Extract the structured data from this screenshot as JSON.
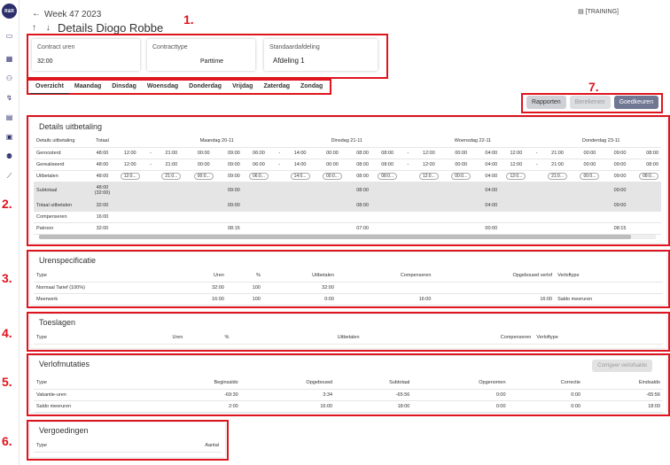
{
  "logo": "R&R",
  "header": {
    "back": "←",
    "week": "Week 47 2023",
    "arrows": "↑ ↓",
    "title": "Details Diogo Robbe",
    "training": "[TRAINING]"
  },
  "annotations": [
    "1.",
    "2.",
    "3.",
    "4.",
    "5.",
    "6.",
    "7."
  ],
  "info": {
    "contract_uren_label": "Contract uren",
    "contract_uren": "32:00",
    "contracttype_label": "Contracttype",
    "contracttype": "Parttime",
    "afdeling_label": "Standaardafdeling",
    "afdeling": "Afdeling 1"
  },
  "tabs": [
    "Overzicht",
    "Maandag",
    "Dinsdag",
    "Woensdag",
    "Donderdag",
    "Vrijdag",
    "Zaterdag",
    "Zondag"
  ],
  "buttons": {
    "rapporten": "Rapporten",
    "berekenen": "Berekenen",
    "goedkeuren": "Goedkeuren"
  },
  "details": {
    "title": "Details uitbetaling",
    "head": [
      "Details uitbetaling",
      "Totaal",
      "Maandag 20-11",
      "Dinsdag 21-11",
      "Woensdag 22-11",
      "Donderdag 23-11"
    ],
    "rows": [
      {
        "label": "Geroosterd",
        "total": "48:00",
        "cells": [
          "12:00",
          "-",
          "21:00",
          "00:00",
          "09:00",
          "06:00",
          "-",
          "14:00",
          "00:00",
          "08:00",
          "08:00",
          "-",
          "12:00",
          "00:00",
          "04:00",
          "12:00",
          "-",
          "21:00",
          "00:00",
          "09:00",
          "08:00"
        ]
      },
      {
        "label": "Gerealiseerd",
        "total": "48:00",
        "cells": [
          "12:00",
          "-",
          "21:00",
          "00:00",
          "09:00",
          "06:00",
          "-",
          "14:00",
          "00:00",
          "08:00",
          "08:00",
          "-",
          "12:00",
          "00:00",
          "04:00",
          "12:00",
          "-",
          "21:00",
          "00:00",
          "09:00",
          "08:00"
        ]
      },
      {
        "label": "Uitbetalen",
        "total": "48:00",
        "pills": [
          "12:0...",
          "21:0...",
          "00:0...",
          "06:0...",
          "14:0...",
          "00:0...",
          "08:0...",
          "12:0...",
          "00:0...",
          "12:0...",
          "21:0...",
          "00:0...",
          "08:0..."
        ],
        "vals": [
          "09:00",
          "08:00",
          "04:00",
          "09:00"
        ]
      }
    ],
    "subtotaal": {
      "label": "Subtotaal",
      "total": "48:00 (32:00)",
      "vals": [
        "09:00",
        "08:00",
        "04:00",
        "09:00"
      ]
    },
    "totaal": {
      "label": "Totaal uitbetalen",
      "total": "32:00",
      "vals": [
        "09:00",
        "08:00",
        "04:00",
        "09:00"
      ]
    },
    "compenseren": {
      "label": "Compenseren",
      "total": "16:00"
    },
    "patroon": {
      "label": "Patroon",
      "total": "32:00",
      "vals": [
        "08:15",
        "07:00",
        "00:00",
        "08:15"
      ]
    }
  },
  "uren": {
    "title": "Urenspecificatie",
    "head": [
      "Type",
      "Uren",
      "%",
      "Uitbetalen",
      "Compenseren",
      "Opgebouwd verlof",
      "Verloftype"
    ],
    "rows": [
      [
        "Normaal Tarief (100%)",
        "32:00",
        "100",
        "32:00",
        "",
        "",
        ""
      ],
      [
        "Meerwerk",
        "16:00",
        "100",
        "0:00",
        "16:00",
        "16:00",
        "Saldo meeruren"
      ]
    ]
  },
  "toeslagen": {
    "title": "Toeslagen",
    "head": [
      "Type",
      "Uren",
      "%",
      "Uitbetalen",
      "Compenseren",
      "Verloftype"
    ]
  },
  "verlof": {
    "title": "Verlofmutaties",
    "button": "Corrigeer verlofsaldo",
    "head": [
      "Type",
      "Beginsaldo",
      "Opgebouwd",
      "Subtotaal",
      "Opgenomen",
      "Correctie",
      "Eindsaldo"
    ],
    "rows": [
      [
        "Vakantie-uren",
        "-69:30",
        "3:34",
        "-65:56",
        "0:00",
        "0:00",
        "-65:56"
      ],
      [
        "Saldo meeruren",
        "2:00",
        "16:00",
        "18:00",
        "0:00",
        "0:00",
        "18:00"
      ]
    ]
  },
  "vergoedingen": {
    "title": "Vergoedingen",
    "head": [
      "Type",
      "Aantal"
    ]
  }
}
